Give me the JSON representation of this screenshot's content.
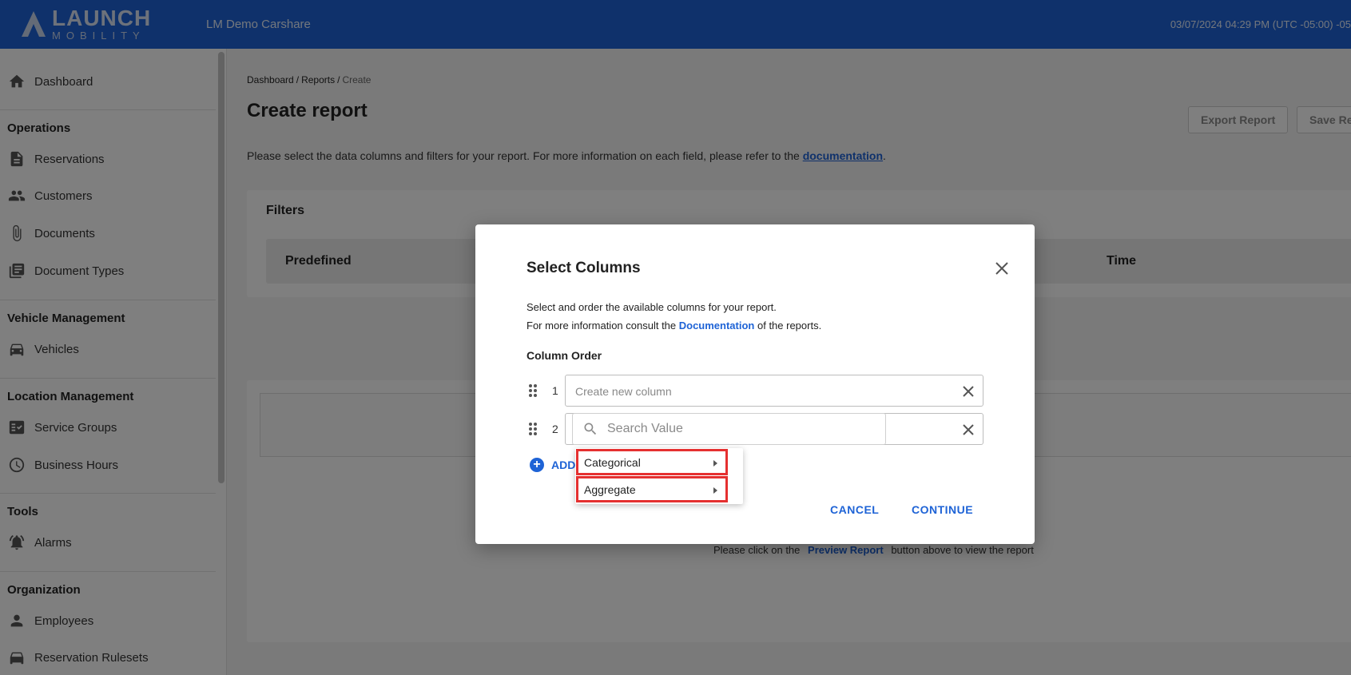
{
  "header": {
    "logo_line1": "LAUNCH",
    "logo_line2": "MOBILITY",
    "org_name": "LM Demo Carshare",
    "datetime": "03/07/2024 04:29 PM (UTC -05:00) -05"
  },
  "sidebar": {
    "dashboard": "Dashboard",
    "sections": {
      "operations": "Operations",
      "vehicle_management": "Vehicle Management",
      "location_management": "Location Management",
      "tools": "Tools",
      "organization": "Organization"
    },
    "items": {
      "reservations": "Reservations",
      "customers": "Customers",
      "documents": "Documents",
      "document_types": "Document Types",
      "vehicles": "Vehicles",
      "service_groups": "Service Groups",
      "business_hours": "Business Hours",
      "alarms": "Alarms",
      "employees": "Employees",
      "reservation_rulesets": "Reservation Rulesets"
    }
  },
  "breadcrumb": {
    "dashboard": "Dashboard",
    "reports": "Reports",
    "create": "Create",
    "sep": "/"
  },
  "page": {
    "title": "Create report",
    "export_label": "Export Report",
    "save_label": "Save Re",
    "intro_text": "Please select the data columns and filters for your report. For more information on each field, please refer to the ",
    "intro_link": "documentation",
    "intro_end": "."
  },
  "filters": {
    "title": "Filters",
    "predefined": "Predefined",
    "time": "Time",
    "hidden_plus": "+"
  },
  "results": {
    "hint_before": "Please click on the",
    "hint_link": "Preview Report",
    "hint_after": "button above to view the report"
  },
  "modal": {
    "title": "Select Columns",
    "desc1": "Select and order the available columns for your report.",
    "desc2_before": "For more information consult the ",
    "desc2_link": "Documentation",
    "desc2_after": " of the reports.",
    "column_order_label": "Column Order",
    "rows": [
      {
        "num": "1",
        "placeholder": "Create new column"
      },
      {
        "num": "2",
        "placeholder": ""
      }
    ],
    "search_placeholder": "Search Value",
    "add_label": "ADD",
    "menu": [
      "Categorical",
      "Aggregate"
    ],
    "cancel": "CANCEL",
    "continue": "CONTINUE"
  },
  "colors": {
    "brand": "#1e63d6",
    "highlight": "#e53030"
  }
}
